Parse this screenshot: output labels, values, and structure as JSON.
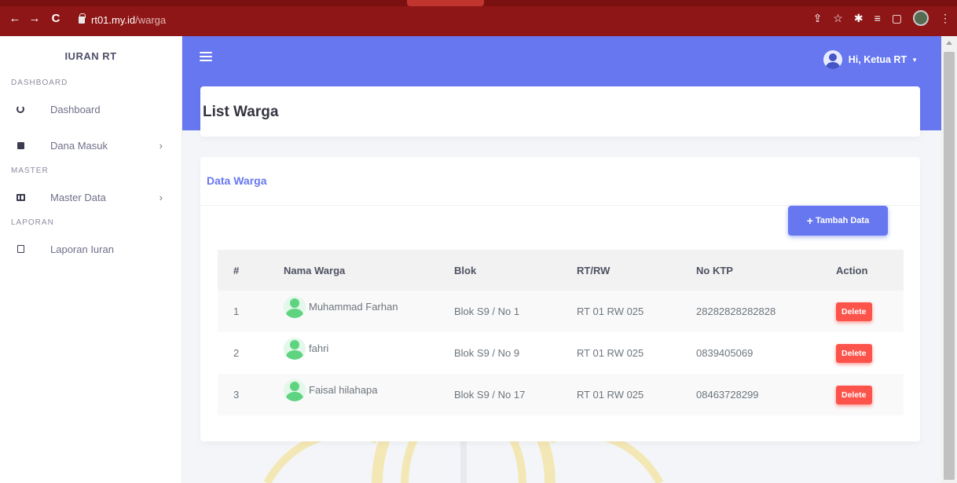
{
  "browser": {
    "url_host": "rt01.my.id",
    "url_path": "/warga",
    "back_icon": "←",
    "forward_icon": "→",
    "reload_icon": "C",
    "right_icons": [
      "share-icon",
      "star-icon",
      "extensions-icon",
      "playlist-icon",
      "sidepanel-icon",
      "profile-avatar",
      "menu-icon"
    ],
    "right_glyphs": [
      "⇪",
      "☆",
      "✱",
      "≡",
      "▢",
      "⋮"
    ]
  },
  "sidebar": {
    "brand": "IURAN RT",
    "sections": [
      {
        "title": "DASHBOARD",
        "items": [
          {
            "label": "Dashboard",
            "icon": "gauge-icon",
            "has_arrow": false
          },
          {
            "label": "Dana Masuk",
            "icon": "square-icon",
            "has_arrow": true
          }
        ]
      },
      {
        "title": "MASTER",
        "items": [
          {
            "label": "Master Data",
            "icon": "columns-icon",
            "has_arrow": true
          }
        ]
      },
      {
        "title": "LAPORAN",
        "items": [
          {
            "label": "Laporan Iuran",
            "icon": "square-outline-icon",
            "has_arrow": false
          }
        ]
      }
    ],
    "chevron": "›"
  },
  "topbar": {
    "user_label": "Hi, Ketua RT",
    "caret": "▼"
  },
  "page": {
    "title": "List Warga"
  },
  "data_card": {
    "title": "Data Warga",
    "add_button": "Tambah Data",
    "add_plus": "+",
    "columns": [
      "#",
      "Nama Warga",
      "Blok",
      "RT/RW",
      "No KTP",
      "Action"
    ],
    "rows": [
      {
        "no": "1",
        "nama": "Muhammad Farhan",
        "blok": "Blok S9 / No 1",
        "rtrw": "RT 01 RW 025",
        "ktp": "28282828282828",
        "action": "Delete"
      },
      {
        "no": "2",
        "nama": "fahri",
        "blok": "Blok S9 / No 9",
        "rtrw": "RT 01 RW 025",
        "ktp": "0839405069",
        "action": "Delete"
      },
      {
        "no": "3",
        "nama": "Faisal hilahapa",
        "blok": "Blok S9 / No 17",
        "rtrw": "RT 01 RW 025",
        "ktp": "08463728299",
        "action": "Delete"
      }
    ]
  },
  "colors": {
    "primary": "#6777ef",
    "danger": "#fc544b",
    "chrome": "#8e1616",
    "avatar_green": "#5ed480"
  }
}
